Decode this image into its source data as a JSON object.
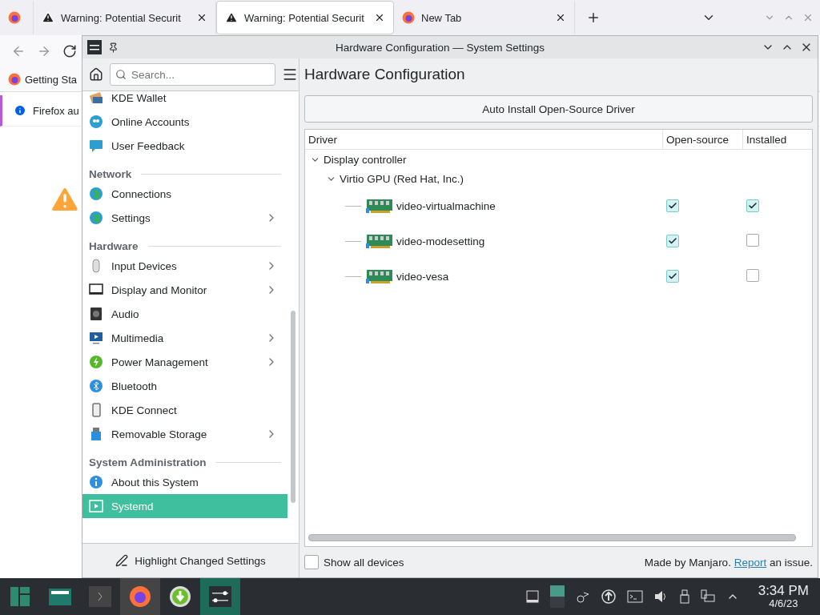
{
  "browser": {
    "tabs": [
      {
        "kind": "firefox",
        "selected": false
      },
      {
        "kind": "warning",
        "title": "Warning: Potential Securit",
        "selected": false
      },
      {
        "kind": "warning",
        "title": "Warning: Potential Securit",
        "selected": true
      },
      {
        "kind": "firefox",
        "title": "New Tab",
        "selected": false
      }
    ],
    "bookmark": "Getting Sta",
    "notification": "Firefox au"
  },
  "settings_window": {
    "title": "Hardware Configuration — System Settings",
    "search": {
      "placeholder": "Search..."
    },
    "sidebar": {
      "items": [
        {
          "kind": "item",
          "label": "KDE Wallet",
          "selected": false,
          "has_children": false
        },
        {
          "kind": "item",
          "label": "Online Accounts",
          "selected": false,
          "has_children": false
        },
        {
          "kind": "item",
          "label": "User Feedback",
          "selected": false,
          "has_children": false
        },
        {
          "kind": "section",
          "label": "Network"
        },
        {
          "kind": "item",
          "label": "Connections",
          "selected": false,
          "has_children": false
        },
        {
          "kind": "item",
          "label": "Settings",
          "selected": false,
          "has_children": true
        },
        {
          "kind": "section",
          "label": "Hardware"
        },
        {
          "kind": "item",
          "label": "Input Devices",
          "selected": false,
          "has_children": true
        },
        {
          "kind": "item",
          "label": "Display and Monitor",
          "selected": false,
          "has_children": true
        },
        {
          "kind": "item",
          "label": "Audio",
          "selected": false,
          "has_children": false
        },
        {
          "kind": "item",
          "label": "Multimedia",
          "selected": false,
          "has_children": true
        },
        {
          "kind": "item",
          "label": "Power Management",
          "selected": false,
          "has_children": true
        },
        {
          "kind": "item",
          "label": "Bluetooth",
          "selected": false,
          "has_children": false
        },
        {
          "kind": "item",
          "label": "KDE Connect",
          "selected": false,
          "has_children": false
        },
        {
          "kind": "item",
          "label": "Removable Storage",
          "selected": false,
          "has_children": true
        },
        {
          "kind": "section",
          "label": "System Administration"
        },
        {
          "kind": "item",
          "label": "About this System",
          "selected": false,
          "has_children": false
        },
        {
          "kind": "item",
          "label": "Systemd",
          "selected": true,
          "has_children": false
        }
      ],
      "highlight_button": "Highlight Changed Settings"
    },
    "page_title": "Hardware Configuration",
    "auto_install_button": "Auto Install Open-Source Driver",
    "table": {
      "columns": [
        "Driver",
        "Open-source",
        "Installed"
      ],
      "tree": [
        {
          "label": "Display controller",
          "expanded": true,
          "children": [
            {
              "label": "Virtio GPU (Red Hat, Inc.)",
              "expanded": true,
              "children": [
                {
                  "label": "video-virtualmachine",
                  "open_source": true,
                  "installed": true
                },
                {
                  "label": "video-modesetting",
                  "open_source": true,
                  "installed": false
                },
                {
                  "label": "video-vesa",
                  "open_source": true,
                  "installed": false
                }
              ]
            }
          ]
        }
      ]
    },
    "show_all_devices": {
      "label": "Show all devices",
      "checked": false
    },
    "footer": {
      "before": "Made by Manjaro.",
      "link": "Report",
      "after": "an issue."
    }
  },
  "taskbar": {
    "time": "3:34 PM",
    "date": "4/6/23"
  }
}
